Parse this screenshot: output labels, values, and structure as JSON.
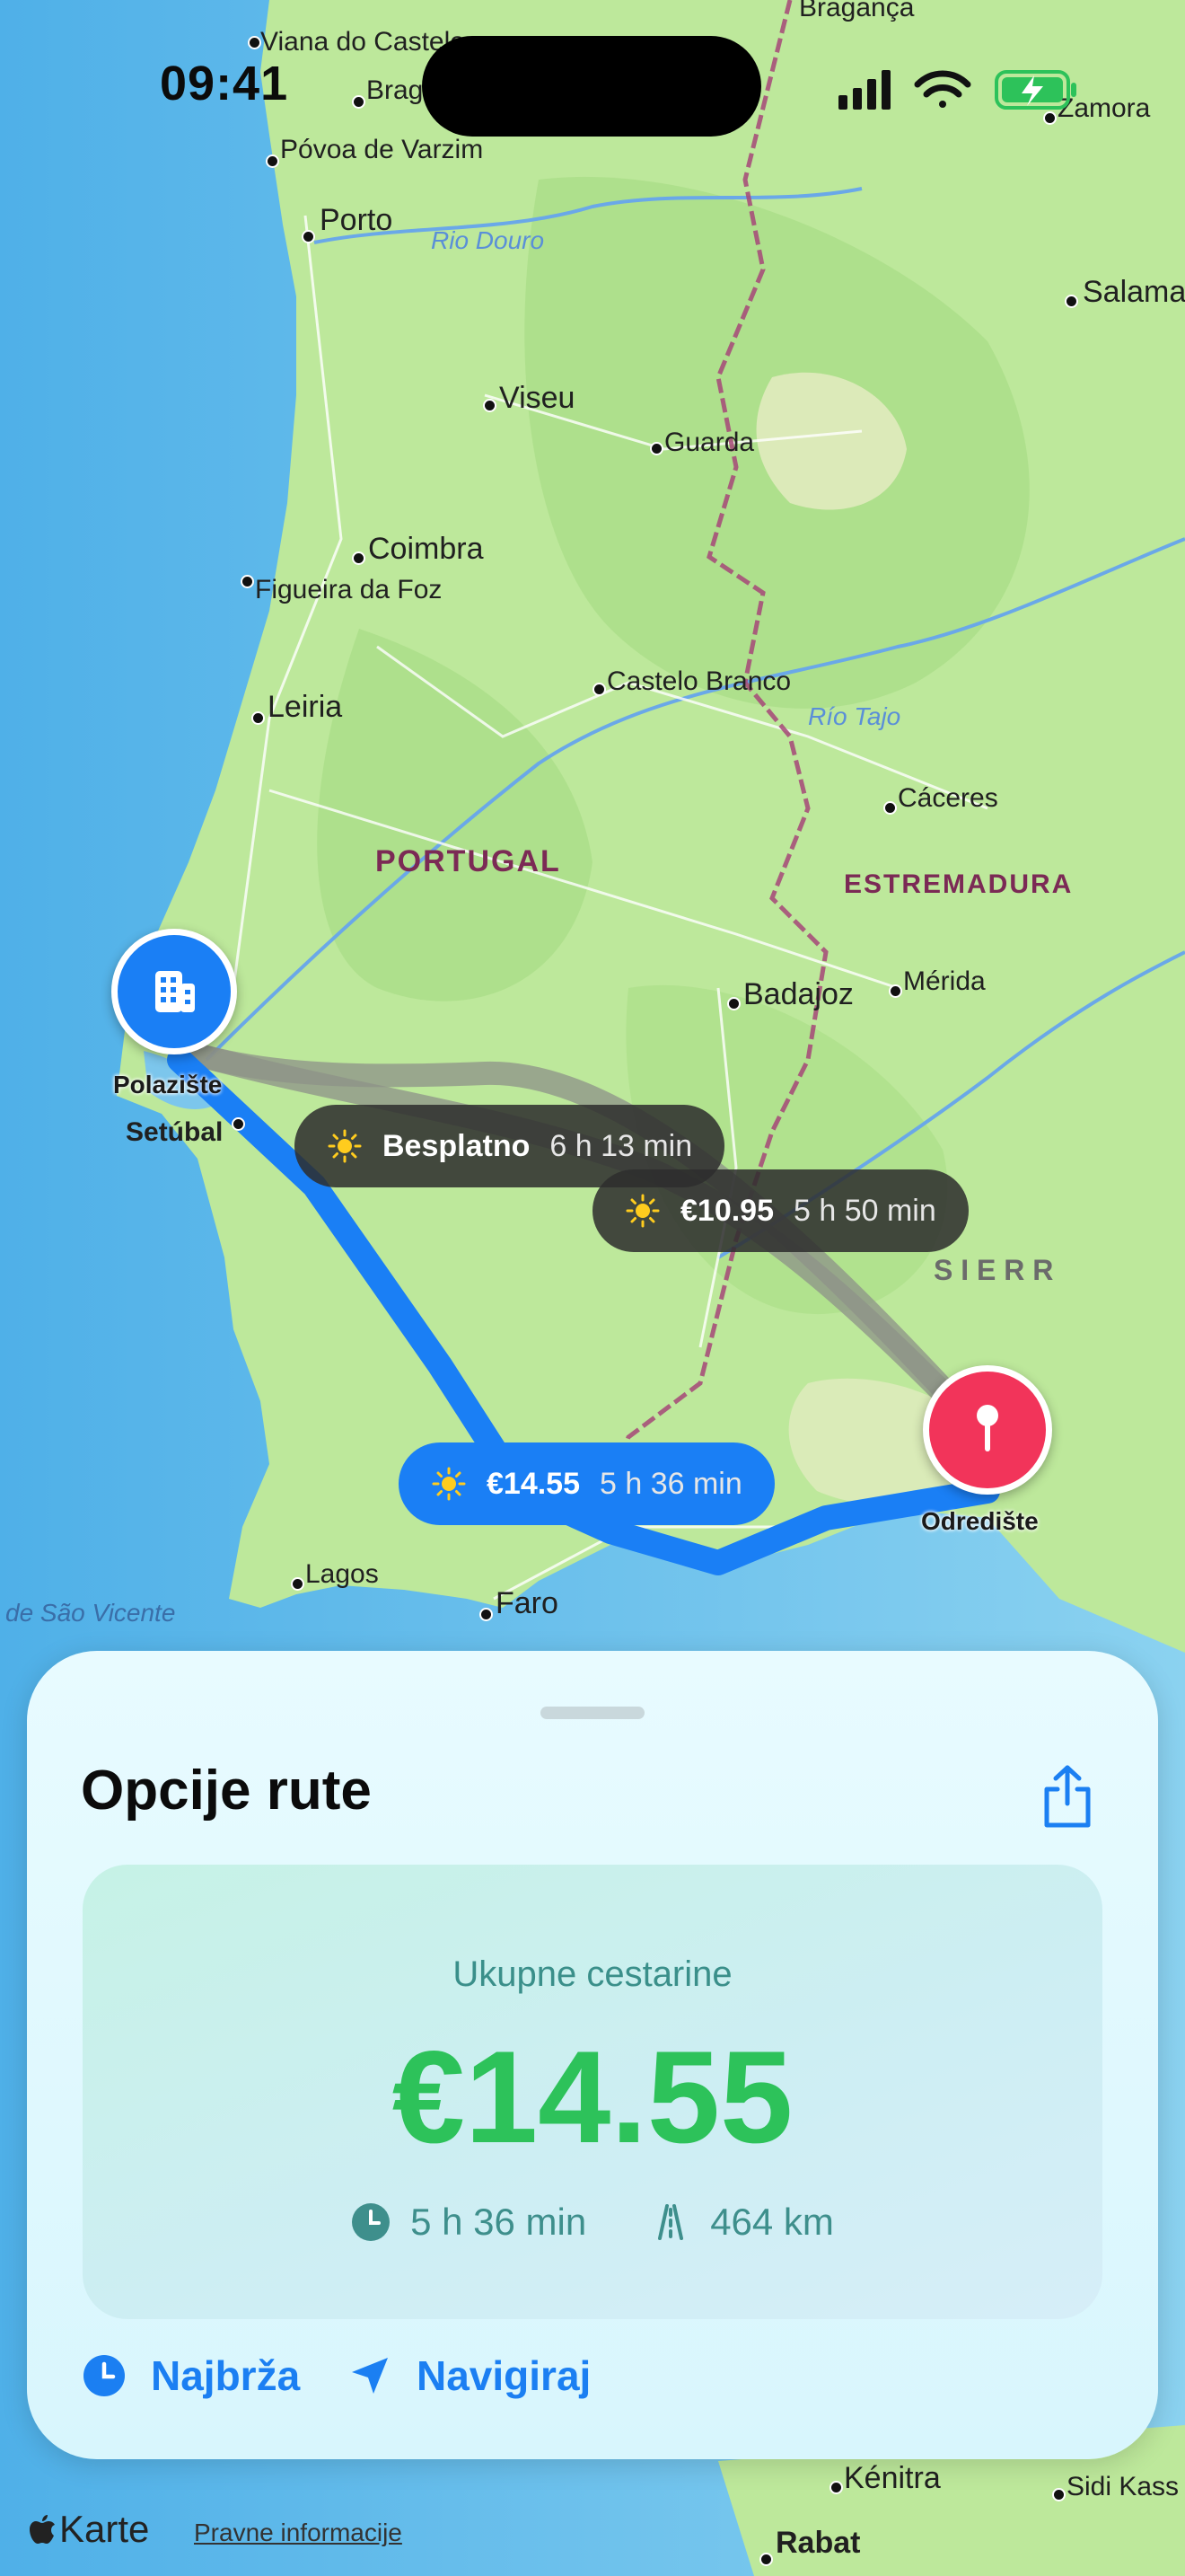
{
  "status_bar": {
    "time": "09:41"
  },
  "map": {
    "labels": {
      "viana": "Viana do Castelo",
      "braga": "Braga",
      "braganca": "Bragança",
      "zamora": "Zamora",
      "povoa": "Póvoa de Varzim",
      "porto": "Porto",
      "rio_douro": "Rio Douro",
      "salamanca": "Salamanca",
      "viseu": "Viseu",
      "guarda": "Guarda",
      "coimbra": "Coimbra",
      "figueira": "Figueira da Foz",
      "castelo_branco": "Castelo Branco",
      "leiria": "Leiria",
      "rio_tajo": "Río Tajo",
      "caceres": "Cáceres",
      "portugal": "PORTUGAL",
      "estremadura": "ESTREMADURA",
      "badajoz": "Badajoz",
      "merida": "Mérida",
      "setubal": "Setúbal",
      "sierra": "S I E R R",
      "lagos": "Lagos",
      "faro": "Faro",
      "sao_vicente": "de São Vicente",
      "kenitra": "Kénitra",
      "sidi_kacem": "Sidi Kass",
      "rabat": "Rabat"
    },
    "origin_label": "Polazište",
    "destination_label": "Odredište",
    "route_pills": [
      {
        "price": "Besplatno",
        "duration": "6 h 13 min",
        "selected": false
      },
      {
        "price": "€10.95",
        "duration": "5 h 50 min",
        "selected": false
      },
      {
        "price": "€14.55",
        "duration": "5 h 36 min",
        "selected": true
      }
    ]
  },
  "sheet": {
    "title": "Opcije rute",
    "card": {
      "label": "Ukupne cestarine",
      "amount": "€14.55",
      "duration": "5 h 36 min",
      "distance": "464 km"
    },
    "actions": {
      "fastest": "Najbrža",
      "navigate": "Navigiraj"
    }
  },
  "footer": {
    "brand": "Karte",
    "legal": "Pravne informacije"
  },
  "colors": {
    "route_selected": "#1a7ff5",
    "route_alt": "#8e9288",
    "toll_green": "#2dc25a",
    "destination": "#f2345a",
    "origin": "#1a7ff5"
  }
}
